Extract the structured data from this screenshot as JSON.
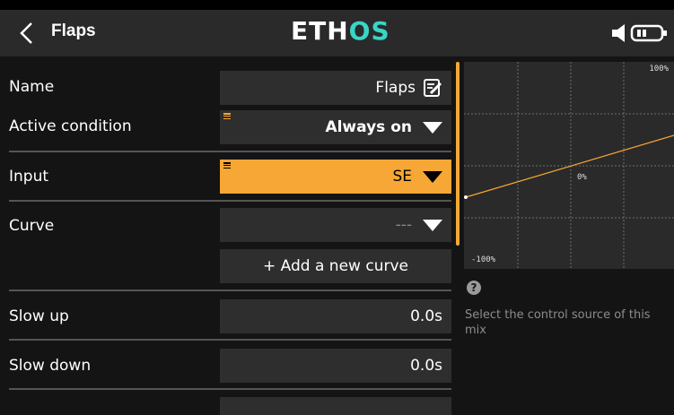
{
  "header": {
    "title": "Flaps",
    "logo_part1": "ETH",
    "logo_part2": "OS"
  },
  "form": {
    "name": {
      "label": "Name",
      "value": "Flaps"
    },
    "active_condition": {
      "label": "Active condition",
      "value": "Always on"
    },
    "input": {
      "label": "Input",
      "value": "SE"
    },
    "curve": {
      "label": "Curve",
      "value": "---",
      "add_button": "+ Add a new curve"
    },
    "slow_up": {
      "label": "Slow up",
      "value": "0.0s"
    },
    "slow_down": {
      "label": "Slow down",
      "value": "0.0s"
    }
  },
  "graph": {
    "top_label": "100%",
    "mid_label": "0%",
    "bottom_label": "-100%"
  },
  "help": {
    "text": "Select the control source of this mix"
  },
  "colors": {
    "accent": "#f7a735",
    "logo_accent": "#38d6c4",
    "background": "#141414",
    "field": "#2e2e2e"
  }
}
